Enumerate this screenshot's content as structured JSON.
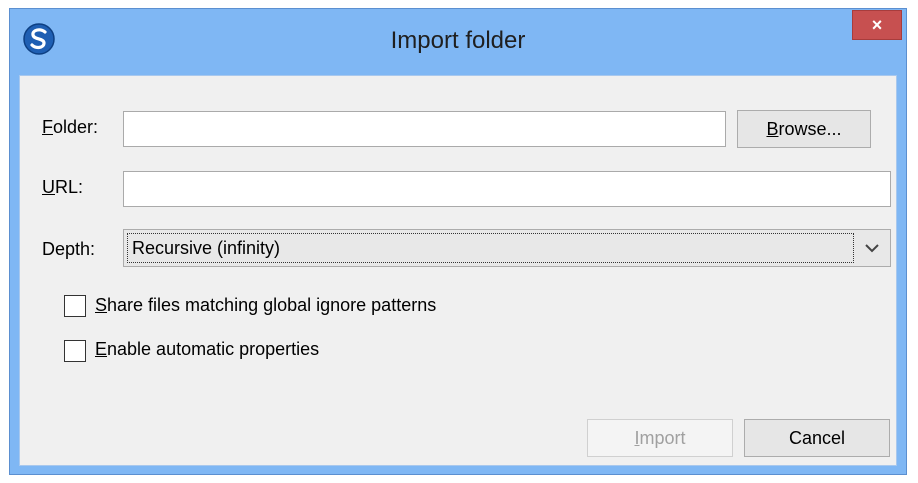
{
  "window": {
    "title": "Import folder",
    "close_glyph": "×"
  },
  "form": {
    "folder": {
      "label_key": "F",
      "label_rest": "older:",
      "value": ""
    },
    "browse_button": {
      "label_key": "B",
      "label_rest": "rowse..."
    },
    "url": {
      "label_key": "U",
      "label_rest": "RL:",
      "value": ""
    },
    "depth": {
      "label": "Depth:",
      "selected": "Recursive (infinity)"
    },
    "share_ignored": {
      "label_key": "S",
      "label_rest": "hare files matching global ignore patterns",
      "checked": false
    },
    "auto_props": {
      "label_key": "E",
      "label_rest": "nable automatic properties",
      "checked": false
    }
  },
  "footer": {
    "import_button": {
      "label_key": "I",
      "label_rest": "mport",
      "enabled": false
    },
    "cancel_button": {
      "label": "Cancel"
    }
  },
  "colors": {
    "titlebar": "#7fb7f4",
    "close_button": "#c75050",
    "dialog_background": "#f0f0f0"
  },
  "icons": {
    "app": "subversion-s-icon",
    "close": "close-icon",
    "dropdown": "chevron-down-icon"
  }
}
